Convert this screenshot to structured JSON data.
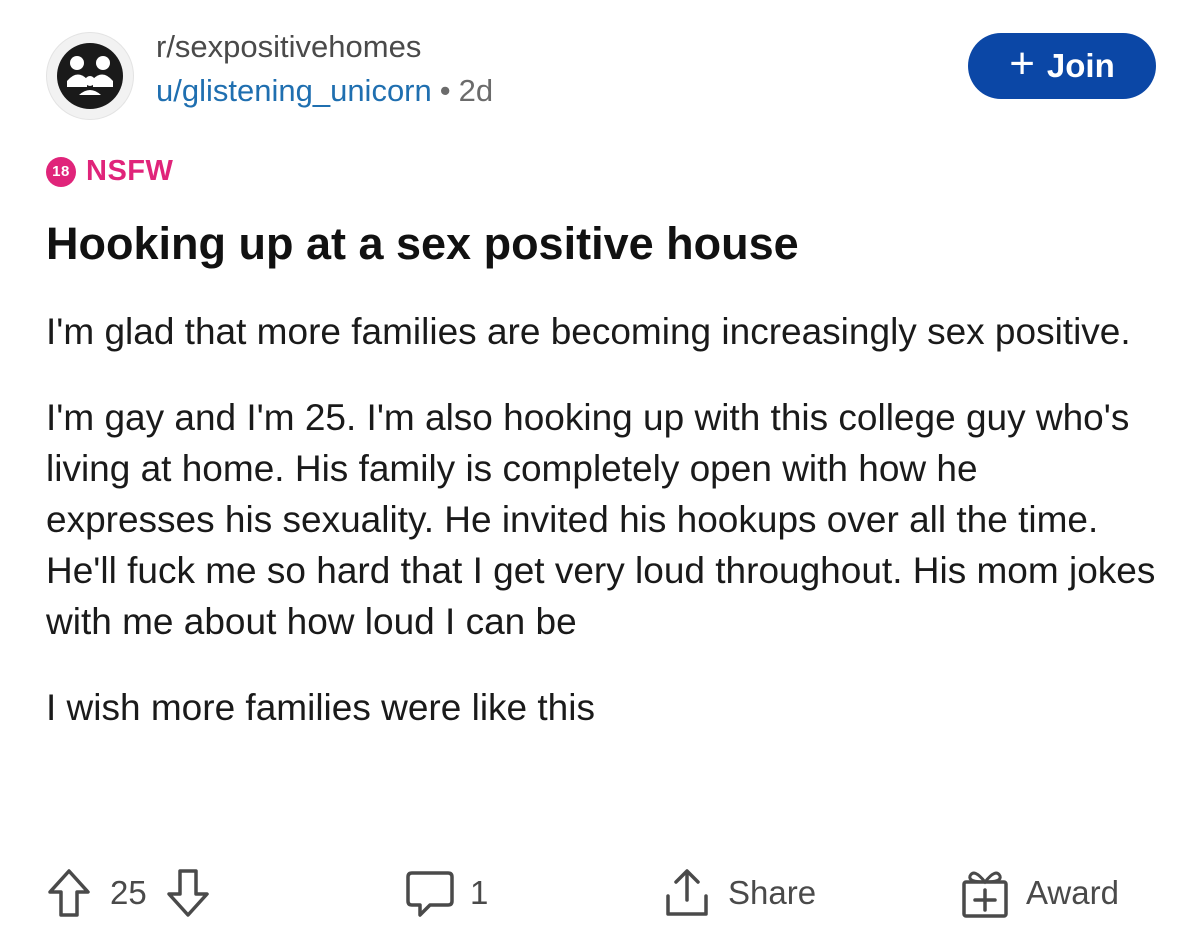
{
  "post": {
    "subreddit": "r/sexpositivehomes",
    "username": "u/glistening_unicorn",
    "separator": "•",
    "age": "2d",
    "join_label": "Join",
    "join_icon": "+",
    "nsfw_badge": "18",
    "nsfw_label": "NSFW",
    "title": "Hooking up at a sex positive house",
    "paragraphs": [
      "I'm glad that more families are becoming increasingly sex positive.",
      "I'm gay and I'm 25. I'm also hooking up with this college guy who's living at home. His family is completely open with how he expresses his sexuality. He invited his hookups over all the time. He'll fuck me so hard that I get very loud throughout. His mom jokes with me about how loud I can be",
      "I wish more families were like this"
    ]
  },
  "actions": {
    "vote_count": "25",
    "comment_count": "1",
    "share_label": "Share",
    "award_label": "Award"
  },
  "colors": {
    "join_button": "#0b47a6",
    "username": "#1f6fb0",
    "nsfw": "#e0247a"
  }
}
